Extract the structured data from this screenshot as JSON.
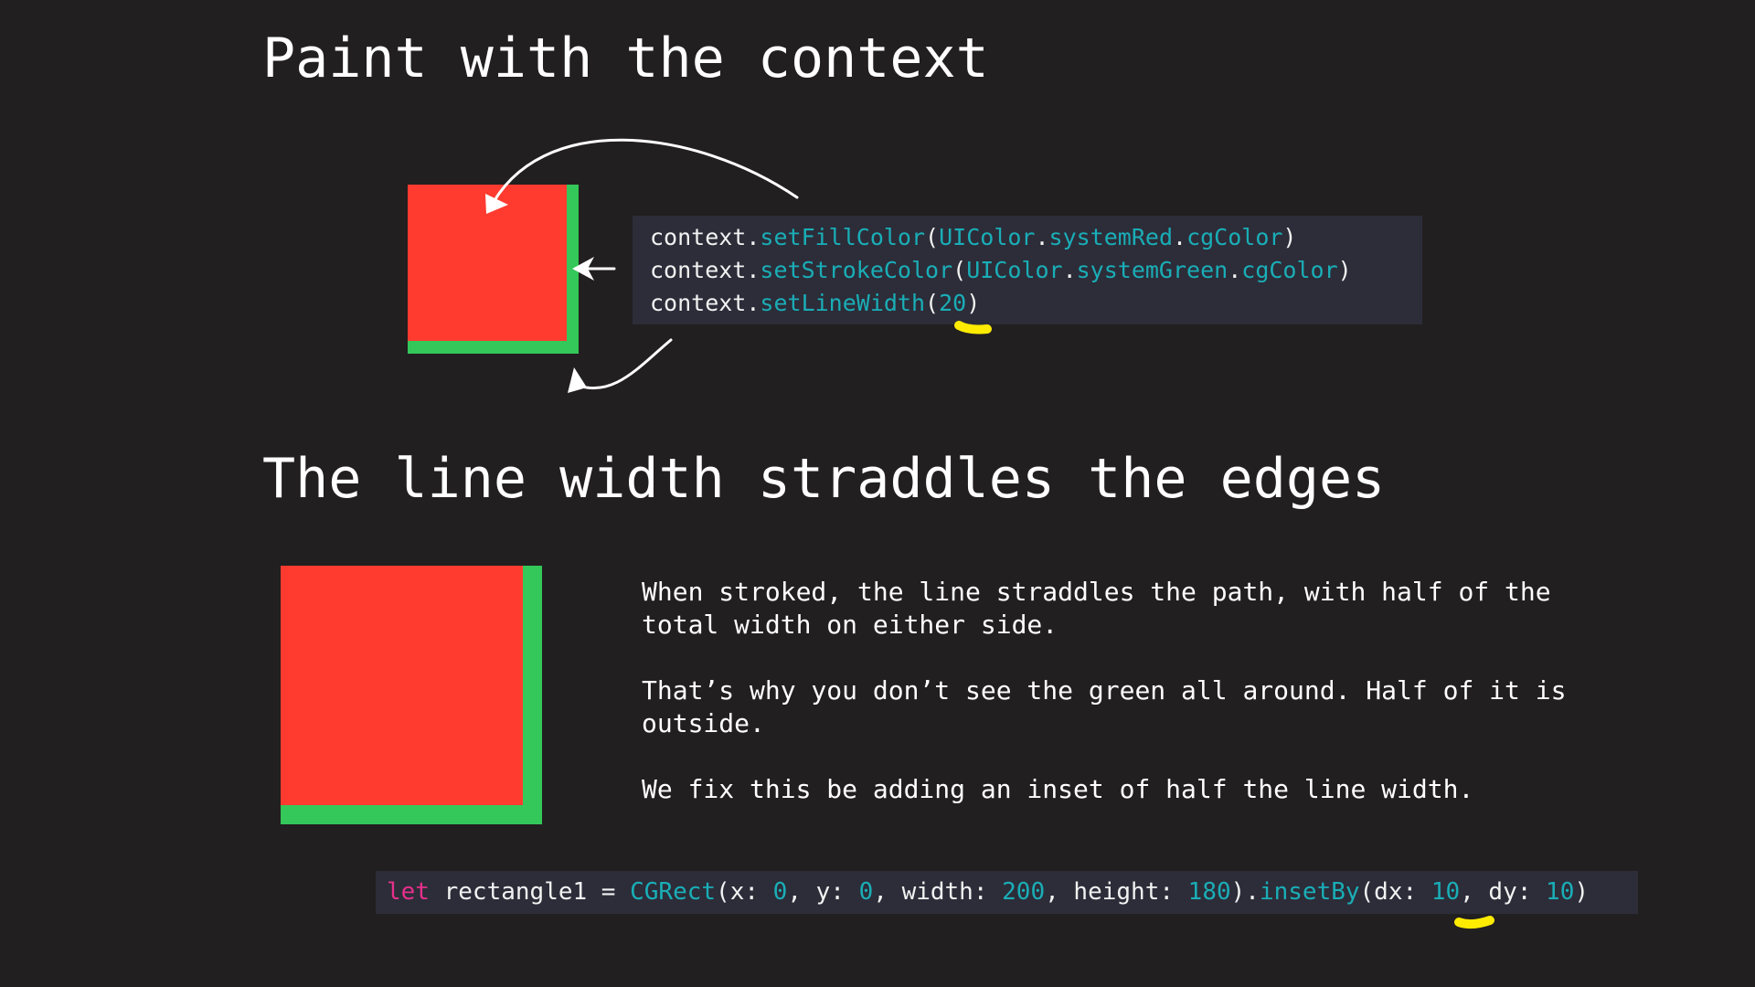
{
  "slide": {
    "title1": "Paint with the context",
    "title2": "The line width straddles the edges"
  },
  "code_block_1": {
    "lines": [
      [
        {
          "text": "context.",
          "kind": "plain"
        },
        {
          "text": "setFillColor",
          "kind": "method"
        },
        {
          "text": "(",
          "kind": "plain"
        },
        {
          "text": "UIColor",
          "kind": "type"
        },
        {
          "text": ".",
          "kind": "plain"
        },
        {
          "text": "systemRed",
          "kind": "method"
        },
        {
          "text": ".",
          "kind": "plain"
        },
        {
          "text": "cgColor",
          "kind": "method"
        },
        {
          "text": ")",
          "kind": "plain"
        }
      ],
      [
        {
          "text": "context.",
          "kind": "plain"
        },
        {
          "text": "setStrokeColor",
          "kind": "method"
        },
        {
          "text": "(",
          "kind": "plain"
        },
        {
          "text": "UIColor",
          "kind": "type"
        },
        {
          "text": ".",
          "kind": "plain"
        },
        {
          "text": "systemGreen",
          "kind": "method"
        },
        {
          "text": ".",
          "kind": "plain"
        },
        {
          "text": "cgColor",
          "kind": "method"
        },
        {
          "text": ")",
          "kind": "plain"
        }
      ],
      [
        {
          "text": "context.",
          "kind": "plain"
        },
        {
          "text": "setLineWidth",
          "kind": "method"
        },
        {
          "text": "(",
          "kind": "plain"
        },
        {
          "text": "20",
          "kind": "num"
        },
        {
          "text": ")",
          "kind": "plain"
        }
      ]
    ]
  },
  "explanation": {
    "paragraph1": "When stroked, the line straddles the path, with half of the\ntotal width on either side.",
    "paragraph2": "That’s why you don’t see the green all around. Half of it is\noutside.",
    "paragraph3": "We fix this be adding an inset of half the line width."
  },
  "code_block_2": {
    "tokens": [
      {
        "text": "let",
        "kind": "kw"
      },
      {
        "text": " rectangle1 = ",
        "kind": "plain"
      },
      {
        "text": "CGRect",
        "kind": "type"
      },
      {
        "text": "(x: ",
        "kind": "plain"
      },
      {
        "text": "0",
        "kind": "num"
      },
      {
        "text": ", y: ",
        "kind": "plain"
      },
      {
        "text": "0",
        "kind": "num"
      },
      {
        "text": ", width: ",
        "kind": "plain"
      },
      {
        "text": "200",
        "kind": "num"
      },
      {
        "text": ", height: ",
        "kind": "plain"
      },
      {
        "text": "180",
        "kind": "num"
      },
      {
        "text": ").",
        "kind": "plain"
      },
      {
        "text": "insetBy",
        "kind": "method"
      },
      {
        "text": "(dx: ",
        "kind": "plain"
      },
      {
        "text": "10",
        "kind": "num"
      },
      {
        "text": ", dy: ",
        "kind": "plain"
      },
      {
        "text": "10",
        "kind": "num"
      },
      {
        "text": ")",
        "kind": "plain"
      }
    ]
  },
  "colors": {
    "background": "#221f20",
    "fill_red": "#ff3b30",
    "stroke_green": "#34c759",
    "code_background": "#2c2d39",
    "code_text": "#f2f2f2",
    "code_accent": "#1aaeb7",
    "code_keyword": "#e6308b",
    "highlight_yellow": "#ffeb00",
    "arrow_white": "#ffffff"
  }
}
